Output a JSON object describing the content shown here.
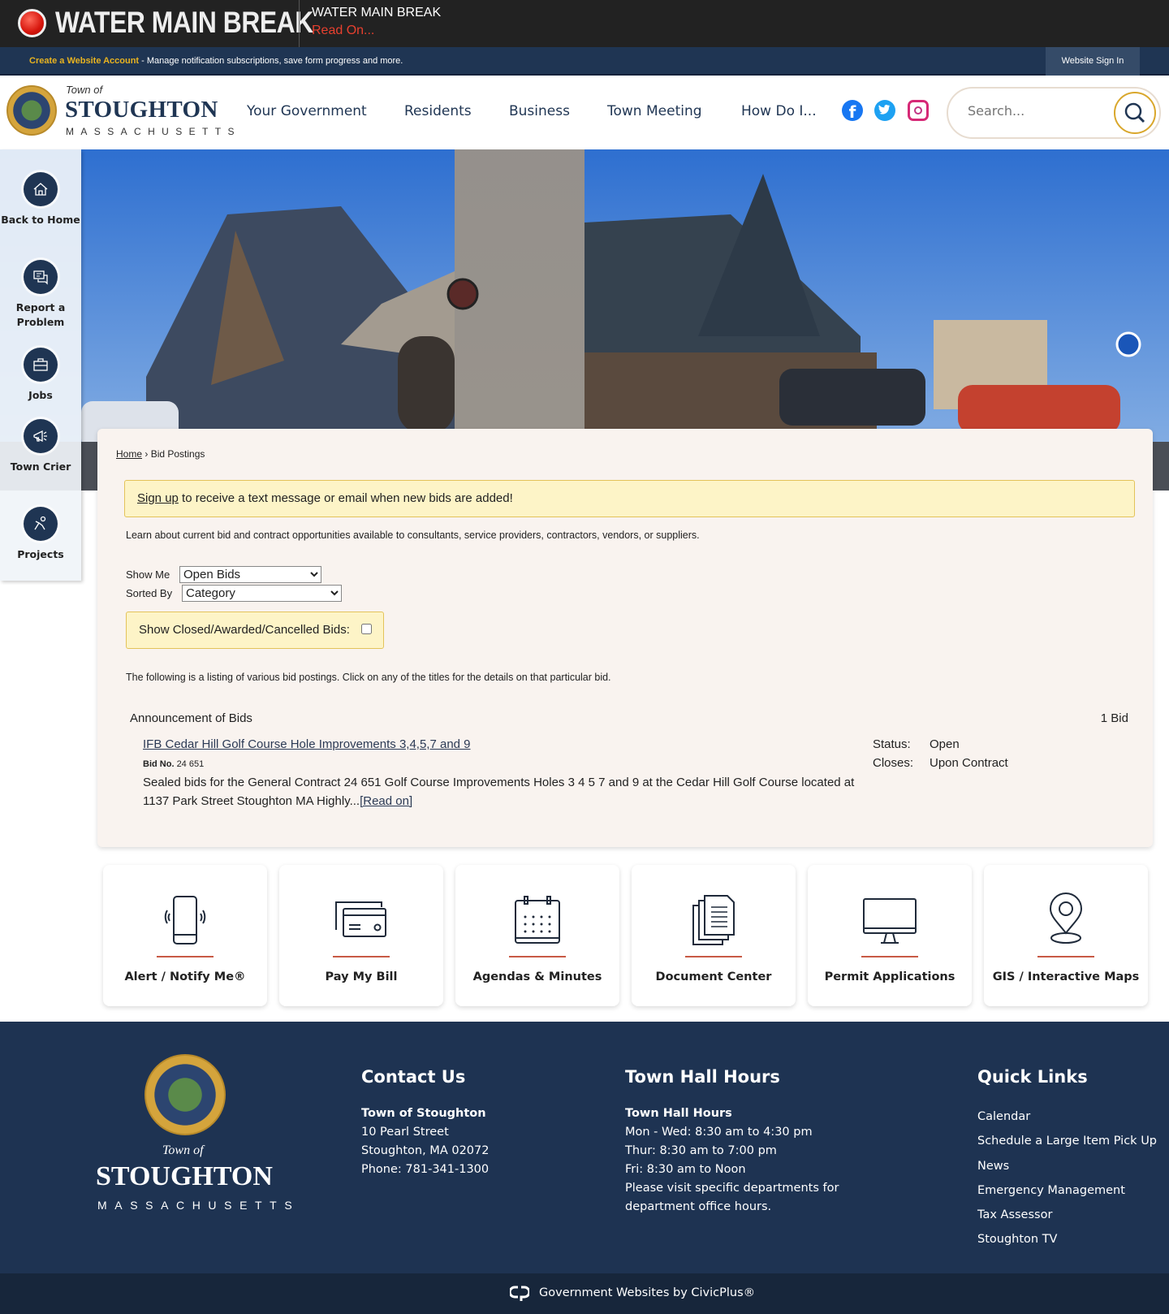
{
  "alert": {
    "banner": "WATER MAIN BREAK",
    "title": "WATER MAIN BREAK",
    "link": "Read On..."
  },
  "account_bar": {
    "create_link": "Create a Website Account",
    "message": " - Manage notification subscriptions, save form progress and more.",
    "sign_in": "Website Sign In"
  },
  "header": {
    "town_of": "Town of",
    "name": "STOUGHTON",
    "state": "MASSACHUSETTS",
    "nav": [
      "Your Government",
      "Residents",
      "Business",
      "Town Meeting",
      "How Do I..."
    ],
    "social": [
      "facebook-icon",
      "twitter-icon",
      "instagram-icon"
    ],
    "search_placeholder": "Search..."
  },
  "sidebar": {
    "items": [
      {
        "label": "Back to Home",
        "icon": "home-icon"
      },
      {
        "label": "Report a Problem",
        "icon": "chat-icon"
      },
      {
        "label": "Jobs",
        "icon": "briefcase-icon"
      },
      {
        "label": "Town Crier",
        "icon": "megaphone-icon"
      },
      {
        "label": "Projects",
        "icon": "construction-worker-icon"
      }
    ]
  },
  "main": {
    "breadcrumb": {
      "home": "Home",
      "sep": " › ",
      "current": "Bid Postings"
    },
    "signup": {
      "link": "Sign up",
      "text": " to receive a text message or email when new bids are added!"
    },
    "intro": "Learn about current bid and contract opportunities available to consultants, service providers, contractors, vendors, or suppliers.",
    "show_me": {
      "label": "Show Me",
      "value": "Open Bids"
    },
    "sorted_by": {
      "label": "Sorted By",
      "value": "Category"
    },
    "show_closed": {
      "label": "Show Closed/Awarded/Cancelled Bids:",
      "checked": false
    },
    "listing_note": "The following is a listing of various bid postings. Click on any of the titles for the details on that particular bid.",
    "category": {
      "name": "Announcement of Bids",
      "count": "1 Bid"
    },
    "bid": {
      "title": "IFB Cedar Hill Golf Course Hole Improvements 3,4,5,7 and 9",
      "bid_no_label": "Bid No.",
      "bid_no": "24 651",
      "description": "Sealed bids for the General Contract 24 651 Golf Course Improvements Holes 3 4 5 7 and 9 at the Cedar Hill Golf Course located at 1137 Park Street Stoughton MA Highly...",
      "read_on": "[Read on]",
      "status_label": "Status:",
      "status": "Open",
      "closes_label": "Closes:",
      "closes": "Upon Contract"
    }
  },
  "tiles": [
    {
      "label": "Alert / Notify Me®",
      "icon": "phone-alert-icon"
    },
    {
      "label": "Pay My Bill",
      "icon": "credit-card-icon"
    },
    {
      "label": "Agendas & Minutes",
      "icon": "calendar-icon"
    },
    {
      "label": "Document Center",
      "icon": "document-icon"
    },
    {
      "label": "Permit Applications",
      "icon": "monitor-icon"
    },
    {
      "label": "GIS / Interactive Maps",
      "icon": "map-pin-icon"
    }
  ],
  "footer": {
    "town_of": "Town of",
    "name": "STOUGHTON",
    "state": "MASSACHUSETTS",
    "contact": {
      "heading": "Contact Us",
      "org": "Town of Stoughton",
      "lines": [
        "10 Pearl Street",
        "Stoughton, MA 02072",
        "Phone: 781-341-1300"
      ]
    },
    "hours": {
      "heading": "Town Hall Hours",
      "sub": "Town Hall Hours",
      "lines": [
        "Mon - Wed: 8:30 am to 4:30 pm",
        "Thur: 8:30 am to 7:00 pm",
        "Fri: 8:30 am to Noon",
        "Please visit specific departments for department office hours."
      ]
    },
    "quick_links": {
      "heading": "Quick Links",
      "items": [
        "Calendar",
        "Schedule a Large Item Pick Up",
        "News",
        "Emergency Management",
        "Tax Assessor",
        "Stoughton TV"
      ]
    },
    "credit": "Government Websites by CivicPlus®"
  },
  "colors": {
    "navy": "#1f3553",
    "alert_red": "#e8402f",
    "gold": "#e8b320",
    "accent_line": "#c85a45"
  }
}
